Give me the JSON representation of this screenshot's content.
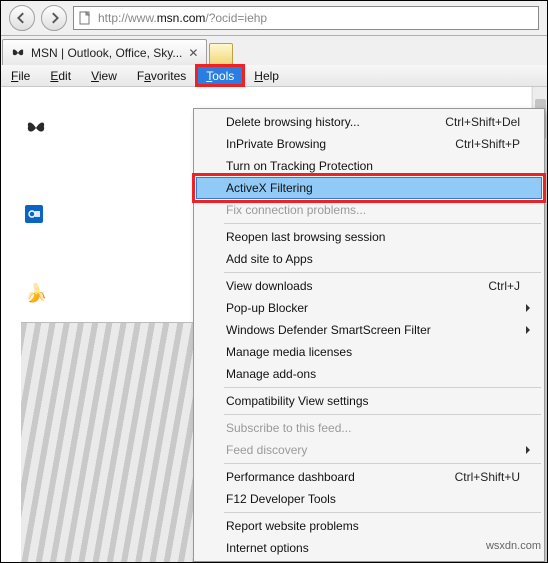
{
  "navbar": {
    "url_gray1": "http://www.",
    "url_dark": "msn.com",
    "url_gray2": "/?ocid=iehp"
  },
  "tab": {
    "title": "MSN | Outlook, Office, Sky..."
  },
  "menubar": {
    "file": "File",
    "edit": "Edit",
    "view": "View",
    "favorites": "Favorites",
    "tools": "Tools",
    "help": "Help"
  },
  "menu": {
    "delete_history": "Delete browsing history...",
    "delete_history_sc": "Ctrl+Shift+Del",
    "inprivate": "InPrivate Browsing",
    "inprivate_sc": "Ctrl+Shift+P",
    "tracking": "Turn on Tracking Protection",
    "activex": "ActiveX Filtering",
    "fix_conn": "Fix connection problems...",
    "reopen": "Reopen last browsing session",
    "add_apps": "Add site to Apps",
    "downloads": "View downloads",
    "downloads_sc": "Ctrl+J",
    "popup": "Pop-up Blocker",
    "smartscreen": "Windows Defender SmartScreen Filter",
    "media": "Manage media licenses",
    "addons": "Manage add-ons",
    "compat": "Compatibility View settings",
    "feed_sub": "Subscribe to this feed...",
    "feed_disc": "Feed discovery",
    "perf": "Performance dashboard",
    "perf_sc": "Ctrl+Shift+U",
    "f12": "F12 Developer Tools",
    "report": "Report website problems",
    "options": "Internet options"
  },
  "watermark": "wsxdn.com"
}
